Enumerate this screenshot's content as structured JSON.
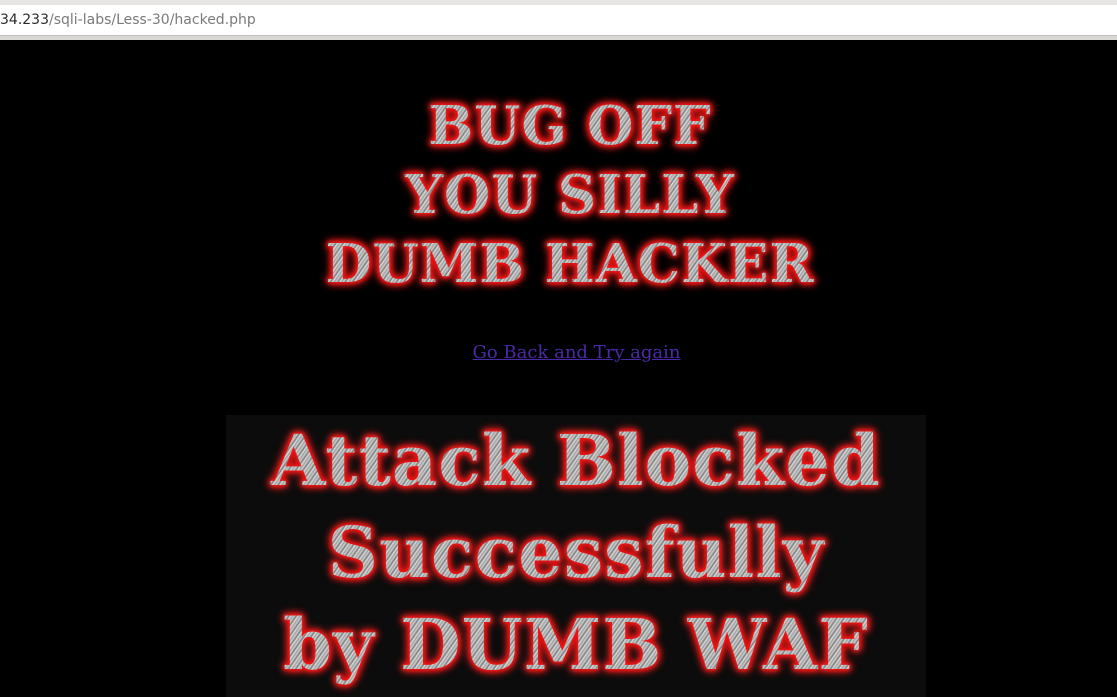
{
  "browser": {
    "url_host": "34.233",
    "url_path": "/sqli-labs/Less-30/hacked.php"
  },
  "page": {
    "banner_lines": [
      "BUG OFF",
      "YOU SILLY",
      "DUMB HACKER"
    ],
    "link_text": "Go Back and Try again",
    "blocked_lines": [
      "Attack Blocked",
      "Successfully",
      "by DUMB WAF"
    ]
  },
  "colors": {
    "background": "#000000",
    "link": "#4b2aa8",
    "glow": "#e00000"
  }
}
